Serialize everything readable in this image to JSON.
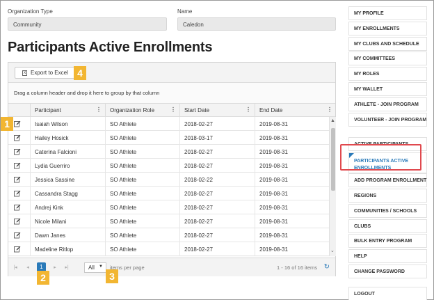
{
  "org_type": {
    "label": "Organization Type",
    "value": "Community"
  },
  "name_field": {
    "label": "Name",
    "value": "Caledon"
  },
  "page_title": "Participants Active Enrollments",
  "toolbar": {
    "export_label": "Export to Excel"
  },
  "group_hint": "Drag a column header and drop it here to group by that column",
  "columns": [
    "Participant",
    "Organization Role",
    "Start Date",
    "End Date"
  ],
  "rows": [
    {
      "participant": "Isaiah Wilson",
      "role": "SO Athlete",
      "start": "2018-02-27",
      "end": "2019-08-31"
    },
    {
      "participant": "Hailey Hosick",
      "role": "SO Athlete",
      "start": "2018-03-17",
      "end": "2019-08-31"
    },
    {
      "participant": "Caterina Falcioni",
      "role": "SO Athlete",
      "start": "2018-02-27",
      "end": "2019-08-31"
    },
    {
      "participant": "Lydia Guerriro",
      "role": "SO Athlete",
      "start": "2018-02-27",
      "end": "2019-08-31"
    },
    {
      "participant": "Jessica Sassine",
      "role": "SO Athlete",
      "start": "2018-02-22",
      "end": "2019-08-31"
    },
    {
      "participant": "Cassandra Stagg",
      "role": "SO Athlete",
      "start": "2018-02-27",
      "end": "2019-08-31"
    },
    {
      "participant": "Andrej Kink",
      "role": "SO Athlete",
      "start": "2018-02-27",
      "end": "2019-08-31"
    },
    {
      "participant": "Nicole Milani",
      "role": "SO Athlete",
      "start": "2018-02-27",
      "end": "2019-08-31"
    },
    {
      "participant": "Dawn Janes",
      "role": "SO Athlete",
      "start": "2018-02-27",
      "end": "2019-08-31"
    },
    {
      "participant": "Madeline Ritlop",
      "role": "SO Athlete",
      "start": "2018-02-27",
      "end": "2019-08-31"
    }
  ],
  "pager": {
    "current_page": "1",
    "page_size": "All",
    "items_per_page": "items per page",
    "count_text": "1 - 16 of 16 items"
  },
  "badges": [
    "1",
    "2",
    "3",
    "4"
  ],
  "sidebar": {
    "items": [
      "MY PROFILE",
      "MY ENROLLMENTS",
      "MY CLUBS AND SCHEDULE",
      "MY COMMITTEES",
      "MY ROLES",
      "MY WALLET",
      "ATHLETE - JOIN PROGRAM",
      "VOLUNTEER - JOIN PROGRAM",
      "ACTIVE PARTICIPANTS",
      "PARTICIPANTS ACTIVE ENROLLMENTS",
      "ADD PROGRAM ENROLLMENT",
      "REGIONS",
      "COMMUNITIES / SCHOOLS",
      "CLUBS",
      "BULK ENTRY PROGRAM",
      "HELP",
      "CHANGE PASSWORD",
      "LOGOUT"
    ],
    "active_index": 9
  },
  "colors": {
    "accent": "#2a7ab9",
    "badge": "#f2b632",
    "highlight": "#e0494e"
  },
  "icons": {
    "edit": "pencil-icon",
    "excel": "excel-icon",
    "refresh": "refresh-icon"
  }
}
